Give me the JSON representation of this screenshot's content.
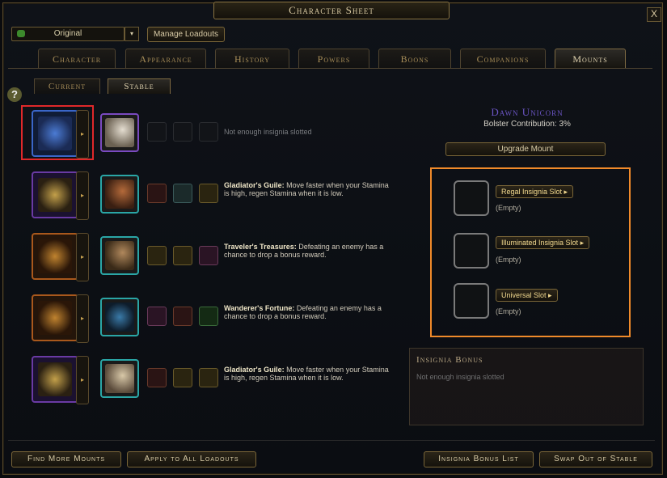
{
  "window": {
    "title": "Character Sheet",
    "close_label": "X"
  },
  "loadout": {
    "selected": "Original",
    "dropdown_icon": "▾",
    "manage_label": "Manage Loadouts"
  },
  "tabs": [
    {
      "label": "Character"
    },
    {
      "label": "Appearance"
    },
    {
      "label": "History"
    },
    {
      "label": "Powers"
    },
    {
      "label": "Boons"
    },
    {
      "label": "Companions"
    },
    {
      "label": "Mounts",
      "active": true
    }
  ],
  "subtabs": [
    {
      "label": "Current"
    },
    {
      "label": "Stable",
      "active": true
    }
  ],
  "help": {
    "icon_label": "?"
  },
  "rows": [
    {
      "frame": "blue",
      "portrait_color": "purple",
      "note": "Not enough insignia slotted"
    },
    {
      "frame": "purple",
      "portrait_color": "teal",
      "bonus_title": "Gladiator's Guile:",
      "bonus_text": " Move faster when your Stamina is high, regen Stamina when it is low."
    },
    {
      "frame": "orange",
      "portrait_color": "teal",
      "bonus_title": "Traveler's Treasures:",
      "bonus_text": " Defeating an enemy has a chance to drop a bonus reward."
    },
    {
      "frame": "orange",
      "portrait_color": "teal",
      "bonus_title": "Wanderer's Fortune:",
      "bonus_text": " Defeating an enemy has a chance to drop a bonus reward."
    },
    {
      "frame": "purple",
      "portrait_color": "teal",
      "bonus_title": "Gladiator's Guile:",
      "bonus_text": " Move faster when your Stamina is high, regen Stamina when it is low."
    }
  ],
  "mount": {
    "name": "Dawn Unicorn",
    "bolster": "Bolster Contribution: 3%",
    "upgrade_label": "Upgrade Mount",
    "slots": [
      {
        "label": "Regal Insignia Slot",
        "state": "(Empty)"
      },
      {
        "label": "Illuminated Insignia Slot",
        "state": "(Empty)"
      },
      {
        "label": "Universal Slot",
        "state": "(Empty)"
      }
    ]
  },
  "insignia_bonus": {
    "title": "Insignia Bonus",
    "text": "Not enough insignia slotted"
  },
  "bottom_buttons": {
    "find": "Find More Mounts",
    "apply": "Apply to All Loadouts",
    "list": "Insignia Bonus List",
    "swap": "Swap Out of Stable"
  },
  "colors": {
    "accent_gold": "#c8a250",
    "mount_name": "#6b55c4",
    "highlight_red": "#e0282a",
    "highlight_orange": "#f08a2a"
  }
}
